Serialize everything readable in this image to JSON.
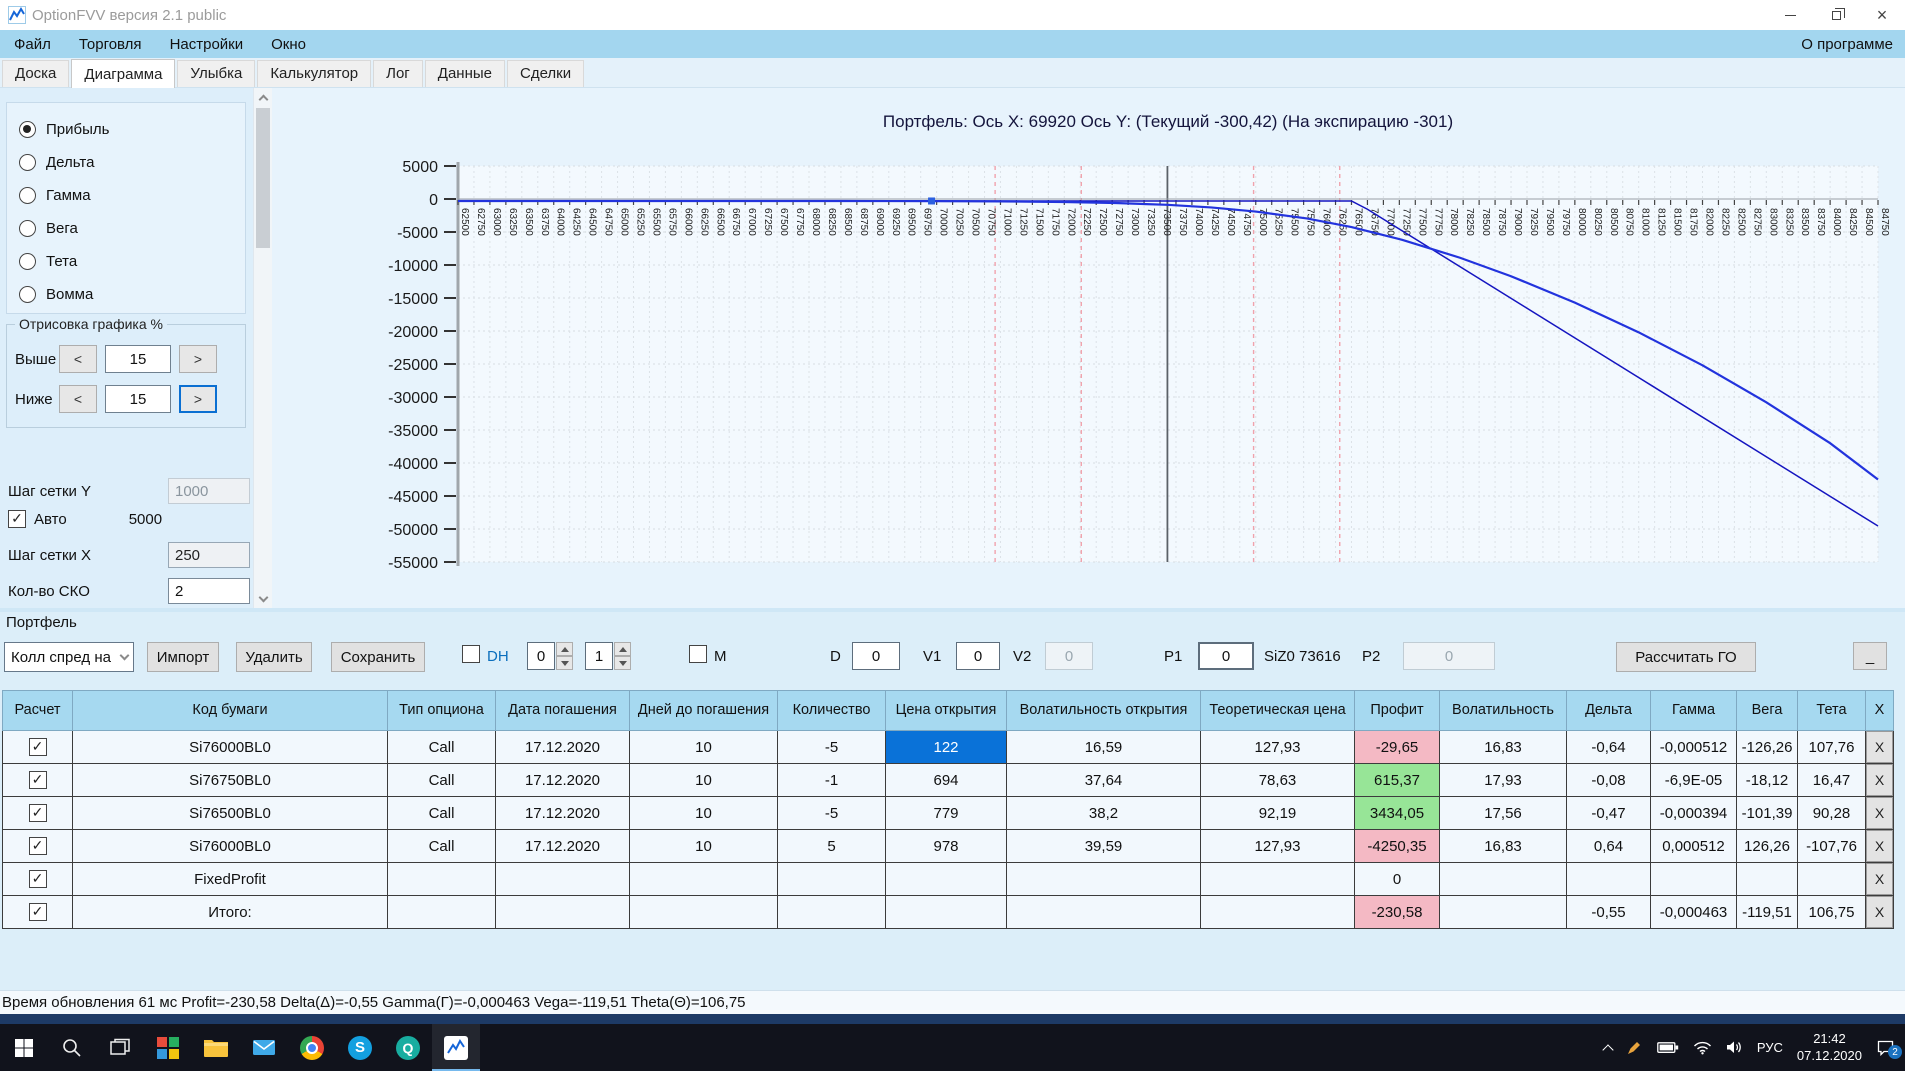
{
  "window": {
    "title": "OptionFVV версия 2.1 public",
    "controls": {
      "minimize": "minimize",
      "maximize": "restore",
      "close": "close"
    }
  },
  "menu": {
    "items": [
      "Файл",
      "Торговля",
      "Настройки",
      "Окно"
    ],
    "right": "О программе"
  },
  "tabs": {
    "items": [
      "Доска",
      "Диаграмма",
      "Улыбка",
      "Калькулятор",
      "Лог",
      "Данные",
      "Сделки"
    ],
    "active": "Диаграмма"
  },
  "left_panel": {
    "modes": [
      {
        "label": "Прибыль",
        "selected": true
      },
      {
        "label": "Дельта",
        "selected": false
      },
      {
        "label": "Гамма",
        "selected": false
      },
      {
        "label": "Вега",
        "selected": false
      },
      {
        "label": "Тета",
        "selected": false
      },
      {
        "label": "Вомма",
        "selected": false
      }
    ],
    "draw_group": {
      "title": "Отрисовка графика %",
      "rows": [
        {
          "label": "Выше",
          "dec": "<",
          "value": "15",
          "inc": ">",
          "inc_focused": false
        },
        {
          "label": "Ниже",
          "dec": "<",
          "value": "15",
          "inc": ">",
          "inc_focused": true
        }
      ]
    },
    "grid_y": {
      "label": "Шаг сетки Y",
      "value": "1000",
      "auto_label": "Авто",
      "auto_checked": true,
      "auto_value": "5000"
    },
    "grid_x": {
      "label": "Шаг сетки X",
      "value": "250"
    },
    "sko": {
      "label": "Кол-во СКО",
      "value": "2"
    }
  },
  "chart_data": {
    "type": "line",
    "title": "Портфель:  Ось X: 69920  Ось Y:   (Текущий -300,42)   (На экспирацию -301)",
    "xlabel": "",
    "ylabel": "",
    "x_min": 62500,
    "x_max": 84750,
    "x_step": 250,
    "y_min": -55000,
    "y_max": 5000,
    "y_step": 5000,
    "grid": true,
    "legend": "none",
    "cursor_x": 69920,
    "cursor_current_y": -300.42,
    "cursor_expiration_y": -301,
    "futures_label": "SiZ0",
    "futures_price_line_x": 73616,
    "sigma_lines_x": [
      70916,
      72266,
      74966,
      76316
    ],
    "marker": {
      "x": 69920,
      "y": -300,
      "color": "#2b5fe0"
    },
    "series": [
      {
        "name": "expiration",
        "color": "#1515c0",
        "points": [
          [
            62500,
            -301
          ],
          [
            76500,
            -301
          ],
          [
            76750,
            -1551
          ],
          [
            84750,
            -49551
          ]
        ]
      },
      {
        "name": "current",
        "color": "#2233dd",
        "points": [
          [
            62500,
            -300
          ],
          [
            66000,
            -302
          ],
          [
            68500,
            -306
          ],
          [
            70000,
            -318
          ],
          [
            71000,
            -355
          ],
          [
            72000,
            -450
          ],
          [
            72800,
            -610
          ],
          [
            73616,
            -880
          ],
          [
            74300,
            -1280
          ],
          [
            75000,
            -1900
          ],
          [
            75800,
            -2950
          ],
          [
            76500,
            -4250
          ],
          [
            77300,
            -6200
          ],
          [
            78200,
            -8900
          ],
          [
            79000,
            -11700
          ],
          [
            80000,
            -15700
          ],
          [
            81000,
            -20200
          ],
          [
            82000,
            -25200
          ],
          [
            83000,
            -30800
          ],
          [
            84000,
            -37000
          ],
          [
            84750,
            -42500
          ]
        ]
      }
    ]
  },
  "portfolio": {
    "section_label": "Портфель",
    "toolbar": {
      "preset_dropdown": {
        "value": "Колл спред на"
      },
      "import_label": "Импорт",
      "delete_label": "Удалить",
      "save_label": "Сохранить",
      "dh": {
        "label": "DH",
        "checked": false
      },
      "spin1": "0",
      "spin2": "1",
      "m": {
        "label": "M",
        "checked": false
      },
      "d": {
        "label": "D",
        "value": "0"
      },
      "v1": {
        "label": "V1",
        "value": "0"
      },
      "v2": {
        "label": "V2",
        "value": "0",
        "disabled": true
      },
      "p1": {
        "label": "P1",
        "value": "0"
      },
      "si_label": "SiZ0 73616",
      "p2": {
        "label": "P2",
        "value": "0",
        "disabled": true
      },
      "calc_label": "Рассчитать ГО",
      "min_label": "_"
    },
    "table": {
      "columns": [
        "Расчет",
        "Код бумаги",
        "Тип опциона",
        "Дата погашения",
        "Дней до погашения",
        "Количество",
        "Цена открытия",
        "Волатильность открытия",
        "Теоретическая цена",
        "Профит",
        "Волатильность",
        "Дельта",
        "Гамма",
        "Вега",
        "Тета",
        "X"
      ],
      "x_button": "X",
      "rows": [
        {
          "checked": true,
          "profit_color": "red",
          "price_selected": true,
          "values": [
            "Si76000BL0",
            "Call",
            "17.12.2020",
            "10",
            "-5",
            "122",
            "16,59",
            "127,93",
            "-29,65",
            "16,83",
            "-0,64",
            "-0,000512",
            "-126,26",
            "107,76"
          ]
        },
        {
          "checked": true,
          "profit_color": "green",
          "price_selected": false,
          "values": [
            "Si76750BL0",
            "Call",
            "17.12.2020",
            "10",
            "-1",
            "694",
            "37,64",
            "78,63",
            "615,37",
            "17,93",
            "-0,08",
            "-6,9E-05",
            "-18,12",
            "16,47"
          ]
        },
        {
          "checked": true,
          "profit_color": "green",
          "price_selected": false,
          "values": [
            "Si76500BL0",
            "Call",
            "17.12.2020",
            "10",
            "-5",
            "779",
            "38,2",
            "92,19",
            "3434,05",
            "17,56",
            "-0,47",
            "-0,000394",
            "-101,39",
            "90,28"
          ]
        },
        {
          "checked": true,
          "profit_color": "red",
          "price_selected": false,
          "values": [
            "Si76000BL0",
            "Call",
            "17.12.2020",
            "10",
            "5",
            "978",
            "39,59",
            "127,93",
            "-4250,35",
            "16,83",
            "0,64",
            "0,000512",
            "126,26",
            "-107,76"
          ]
        },
        {
          "checked": true,
          "profit_color": "",
          "price_selected": false,
          "values": [
            "FixedProfit",
            "",
            "",
            "",
            "",
            "",
            "",
            "",
            "0",
            "",
            "",
            "",
            "",
            ""
          ]
        },
        {
          "checked": true,
          "profit_color": "red",
          "price_selected": false,
          "values": [
            "Итого:",
            "",
            "",
            "",
            "",
            "",
            "",
            "",
            "-230,58",
            "",
            "-0,55",
            "-0,000463",
            "-119,51",
            "106,75"
          ]
        }
      ]
    }
  },
  "status_bar": {
    "text": "Время обновления 61 мс  Profit=-230,58 Delta(Δ)=-0,55 Gamma(Г)=-0,000463 Vega=-119,51 Theta(Θ)=106,75"
  },
  "taskbar": {
    "app_icons": [
      "start-icon",
      "search-icon",
      "task-view-icon",
      "tiles-app-icon",
      "file-explorer-icon",
      "mail-icon",
      "chrome-icon",
      "skype-icon",
      "quik-icon",
      "optionfvv-icon"
    ],
    "tray_icons": [
      "tray-expand-icon",
      "pen-icon",
      "battery-icon",
      "wifi-icon",
      "speaker-icon",
      "notification-icon"
    ],
    "skype_letter": "S",
    "quik_letter": "Q",
    "language": "РУС",
    "time": "21:42",
    "date": "07.12.2020",
    "badge": "2"
  },
  "colors": {
    "accent": "#0a72d8",
    "menu_bg": "#a3d6ef",
    "header_bg": "#a6d9f0",
    "profit_red": "#f4b9c4",
    "profit_green": "#97e597",
    "curve_blue": "#2233dd",
    "selection_blue": "#0a72d8",
    "taskbar_bg": "#11131c"
  }
}
